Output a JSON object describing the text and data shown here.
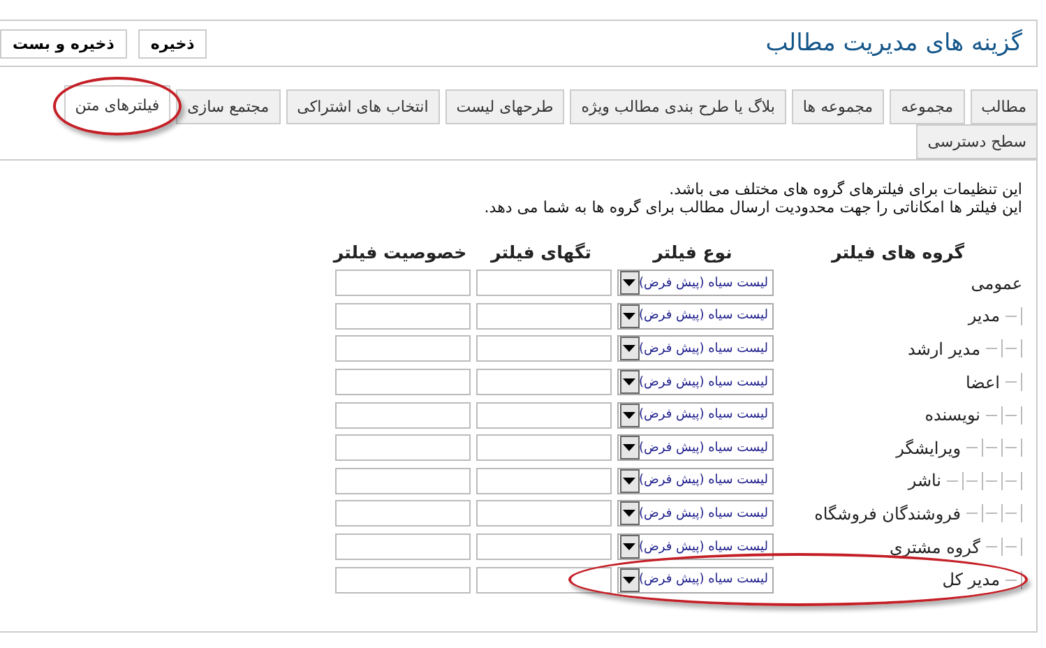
{
  "header": {
    "title": "گزینه های مدیریت مطالب",
    "buttons": [
      "ذخیره",
      "ذخیره و بست"
    ]
  },
  "tabs": [
    {
      "label": "مطالب",
      "selected": false,
      "highlighted": false
    },
    {
      "label": "مجموعه",
      "selected": false,
      "highlighted": false
    },
    {
      "label": "مجموعه ها",
      "selected": false,
      "highlighted": false
    },
    {
      "label": "بلاگ یا طرح بندی مطالب ویژه",
      "selected": false,
      "highlighted": false
    },
    {
      "label": "طرحهای لیست",
      "selected": false,
      "highlighted": false
    },
    {
      "label": "انتخاب های اشتراکی",
      "selected": false,
      "highlighted": false
    },
    {
      "label": "مجتمع سازی",
      "selected": false,
      "highlighted": false
    },
    {
      "label": "فیلترهای متن",
      "selected": true,
      "highlighted": true
    }
  ],
  "tabs_row2": [
    {
      "label": "سطح دسترسی",
      "selected": false,
      "highlighted": false
    }
  ],
  "description": [
    "این تنظیمات برای فیلترهای گروه های مختلف می باشد.",
    "این فیلتر ها امکاناتی را جهت محدودیت ارسال مطالب برای گروه ها به شما می دهد."
  ],
  "table": {
    "columns": [
      "گروه های فیلتر",
      "نوع فیلتر",
      "تگهای فیلتر",
      "خصوصیت فیلتر"
    ],
    "groups": [
      {
        "name": "عمومی",
        "filter_type": "لیست سیاه (پیش فرض)",
        "highlighted": false,
        "children": [
          {
            "name": "مدیر",
            "filter_type": "لیست سیاه (پیش فرض)",
            "highlighted": false,
            "children": [
              {
                "name": "مدیر ارشد",
                "filter_type": "لیست سیاه (پیش فرض)",
                "highlighted": false
              }
            ]
          },
          {
            "name": "اعضا",
            "filter_type": "لیست سیاه (پیش فرض)",
            "highlighted": false,
            "children": [
              {
                "name": "نویسنده",
                "filter_type": "لیست سیاه (پیش فرض)",
                "highlighted": false,
                "children": [
                  {
                    "name": "ویرایشگر",
                    "filter_type": "لیست سیاه (پیش فرض)",
                    "highlighted": false,
                    "children": [
                      {
                        "name": "ناشر",
                        "filter_type": "لیست سیاه (پیش فرض)",
                        "highlighted": false
                      }
                    ]
                  },
                  {
                    "name": "فروشندگان فروشگاه",
                    "filter_type": "لیست سیاه (پیش فرض)",
                    "highlighted": false
                  }
                ]
              },
              {
                "name": "گروه مشتری",
                "filter_type": "لیست سیاه (پیش فرض)",
                "highlighted": false
              }
            ]
          },
          {
            "name": "مدیر کل",
            "filter_type": "لیست سیاه (پیش فرض)",
            "highlighted": true
          }
        ]
      }
    ]
  }
}
